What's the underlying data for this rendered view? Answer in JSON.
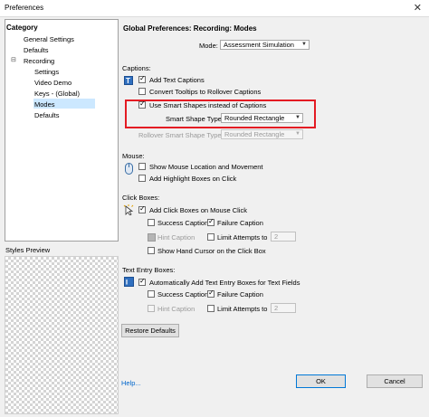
{
  "window": {
    "title": "Preferences",
    "close_glyph": "✕"
  },
  "category": {
    "title": "Category",
    "items": [
      {
        "label": "General Settings"
      },
      {
        "label": "Defaults"
      },
      {
        "label": "Recording",
        "expander": "⊟"
      },
      {
        "label": "Settings"
      },
      {
        "label": "Video Demo"
      },
      {
        "label": "Keys - (Global)"
      },
      {
        "label": "Modes"
      },
      {
        "label": "Defaults"
      }
    ]
  },
  "styles_preview": {
    "label": "Styles Preview"
  },
  "main": {
    "heading": "Global Preferences: Recording: Modes",
    "mode_label": "Mode:",
    "mode_value": "Assessment Simulation",
    "captions": {
      "section": "Captions:",
      "add_text_captions": "Add Text Captions",
      "convert_tooltips": "Convert Tooltips to Rollover Captions",
      "use_smart_shapes": "Use Smart Shapes instead of Captions",
      "smart_shape_type_label": "Smart Shape Type",
      "smart_shape_type_value": "Rounded Rectangle",
      "rollover_label": "Rollover Smart Shape Type",
      "rollover_value": "Rounded Rectangle"
    },
    "mouse": {
      "section": "Mouse:",
      "show_mouse": "Show Mouse Location and Movement",
      "add_highlight": "Add Highlight Boxes on Click"
    },
    "click_boxes": {
      "section": "Click Boxes:",
      "add_click_boxes": "Add Click Boxes on Mouse Click",
      "success_caption": "Success Caption",
      "failure_caption": "Failure Caption",
      "hint_caption": "Hint Caption",
      "limit_attempts": "Limit Attempts to",
      "limit_value": "2",
      "show_hand": "Show Hand Cursor on the Click Box"
    },
    "text_entry": {
      "section": "Text Entry Boxes:",
      "auto_add": "Automatically Add Text Entry Boxes for Text Fields",
      "success_caption": "Success Caption",
      "failure_caption": "Failure Caption",
      "hint_caption": "Hint Caption",
      "limit_attempts": "Limit Attempts to",
      "limit_value": "2"
    },
    "restore_defaults": "Restore Defaults"
  },
  "footer": {
    "help": "Help...",
    "ok": "OK",
    "cancel": "Cancel"
  },
  "colors": {
    "highlight_box": "#e41b23",
    "selected_item": "#cce8ff",
    "link": "#0066cc"
  }
}
